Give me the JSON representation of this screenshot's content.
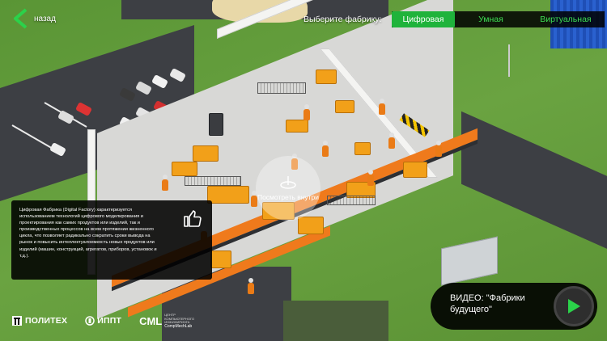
{
  "nav": {
    "back_label": "назад"
  },
  "factory_select": {
    "prompt": "Выберите фабрику:",
    "tabs": [
      {
        "label": "Цифровая",
        "active": true
      },
      {
        "label": "Умная",
        "active": false
      },
      {
        "label": "Виртуальная",
        "active": false
      }
    ]
  },
  "scene": {
    "center_button_label": "Посмотреть внутри"
  },
  "info_panel": {
    "text": "Цифровая Фабрика (Digital Factory) характеризуется использованием технологий цифрового моделирования и проектирования как самих продуктов или изделий, так и производственных процессов на всем протяжении жизненного цикла, что позволяет радикально сократить сроки вывода на рынок и повысить интеллектуалоемкость новых продуктов или изделий (машин, конструкций, агрегатов, приборов, установок и т.д.)."
  },
  "video": {
    "title": "ВИДЕО: \"Фабрики будущего\""
  },
  "logos": {
    "politech": "ПОЛИТЕХ",
    "ippt": "ИППТ",
    "cml": "CML",
    "cml_sub": "ЦЕНТР КОМПЬЮТЕРНОГО ИНЖИНИРИНГА",
    "cml_url": "CompMechLab"
  },
  "colors": {
    "accent_green": "#1fb33b",
    "tab_text_green": "#3ddc52",
    "factory_orange": "#ef7a1c",
    "grass": "#6aa341"
  },
  "icons": [
    "chevron-left-icon",
    "thumbs-up-icon",
    "play-icon",
    "cursor-icon"
  ]
}
